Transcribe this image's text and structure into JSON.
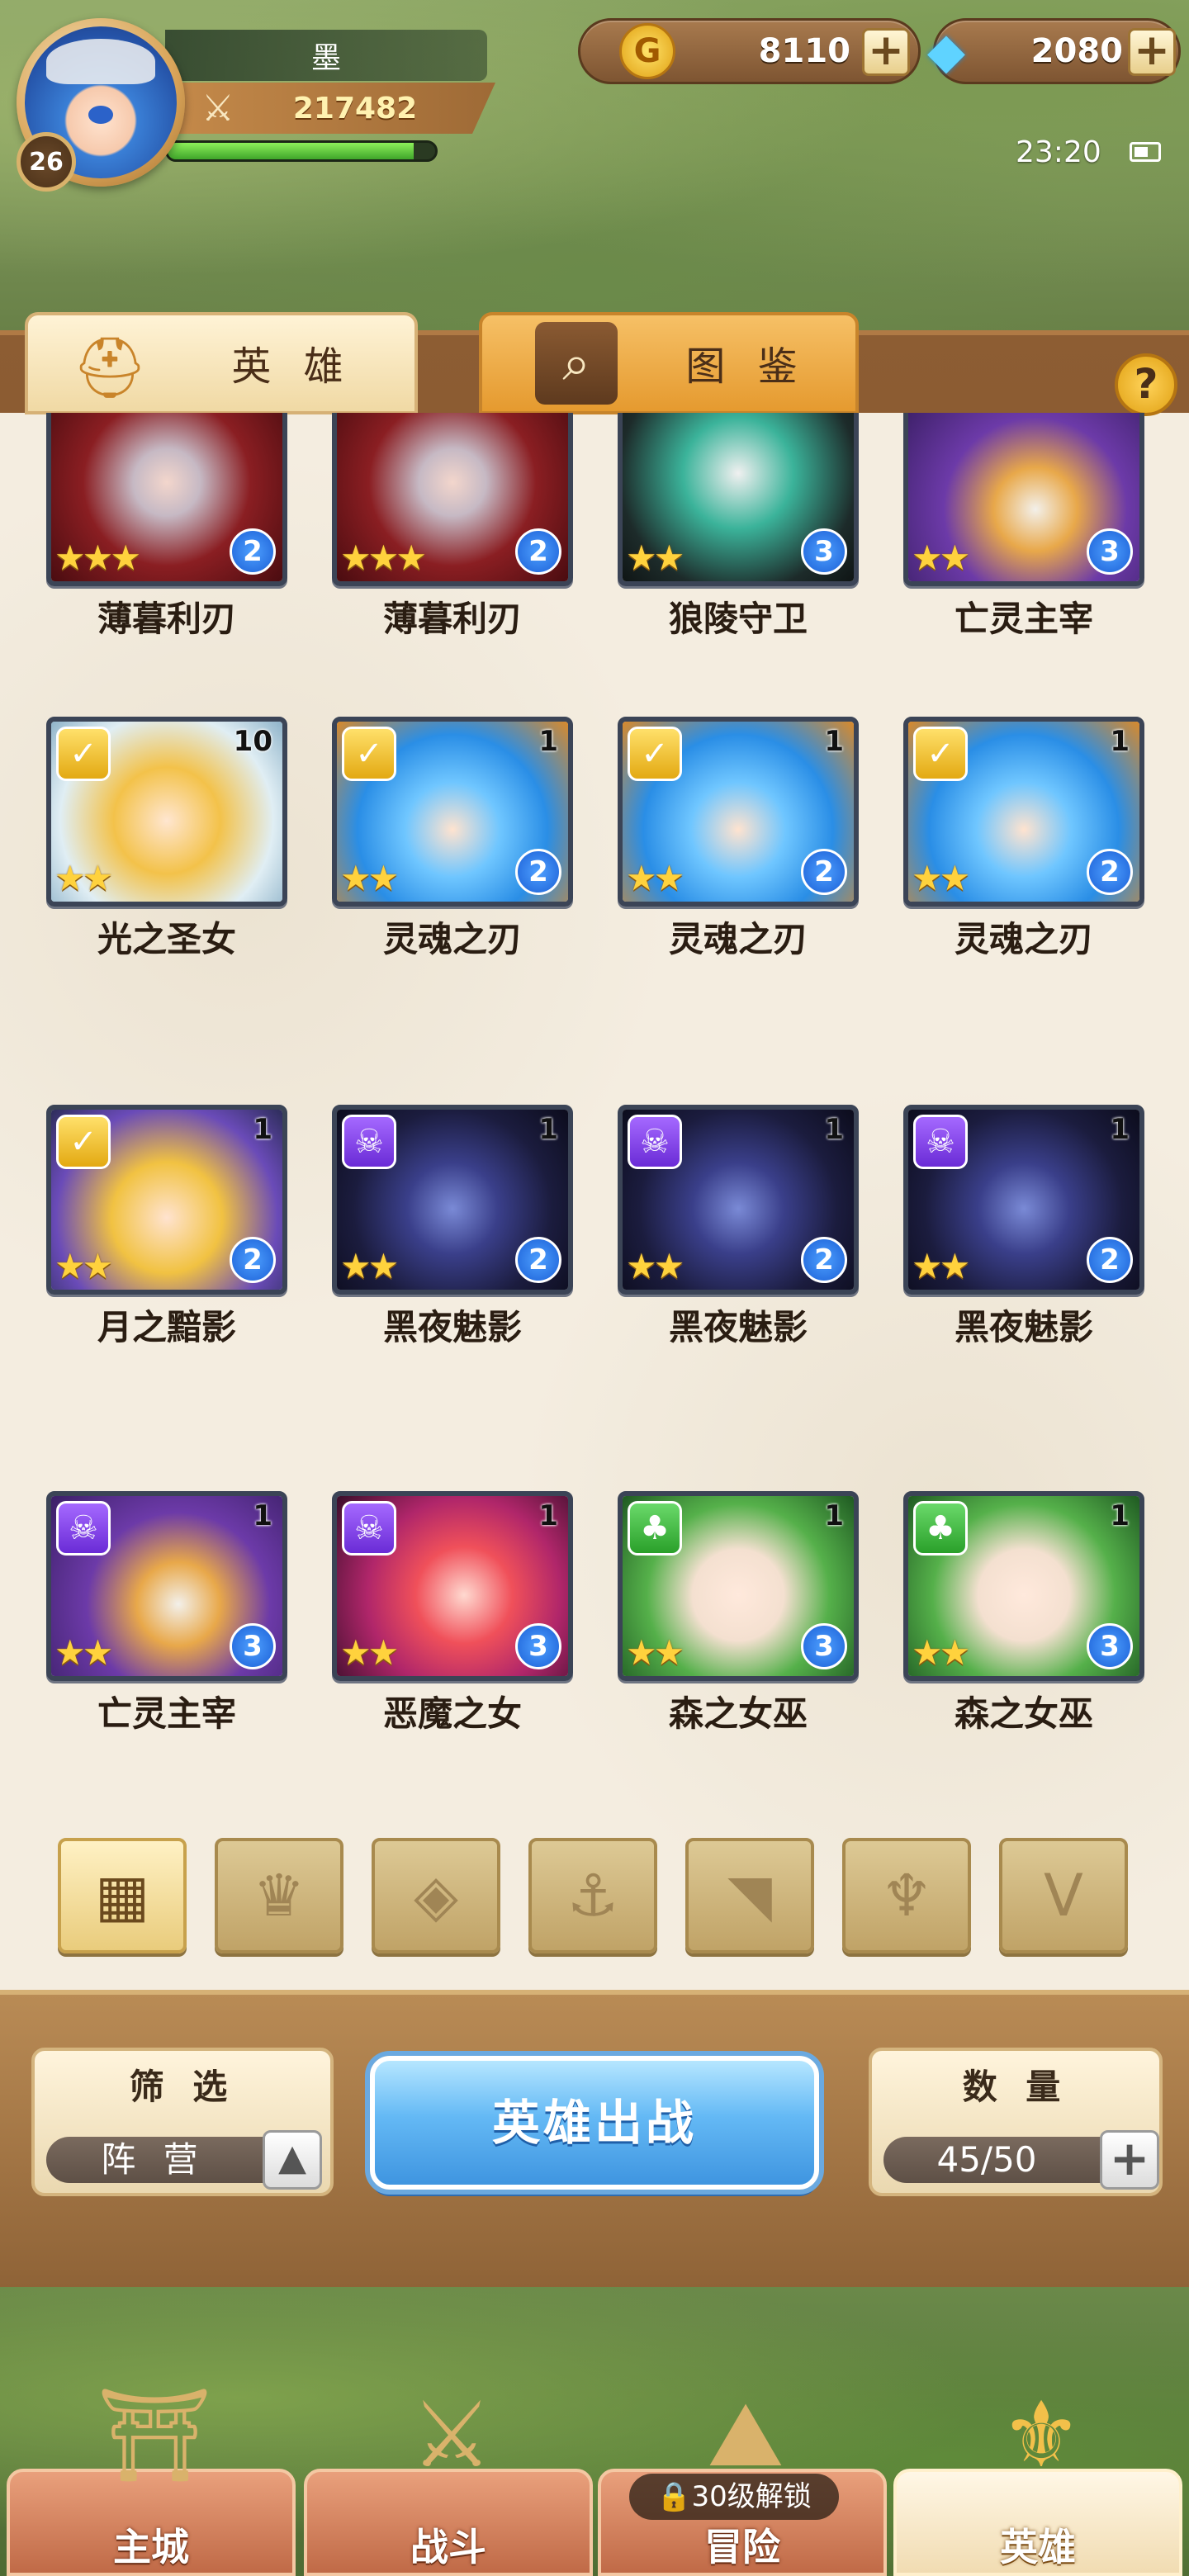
{
  "player": {
    "name": "墨",
    "level": "26",
    "power": "217482",
    "exp_fraction": 0.92
  },
  "resources": {
    "coin": "8110",
    "gem": "2080"
  },
  "status_bar": {
    "time": "23:20"
  },
  "tabs": [
    {
      "label": "英 雄",
      "active": true
    },
    {
      "label": "图 鉴",
      "active": false
    }
  ],
  "help_label": "?",
  "heroes": [
    {
      "name": "薄暮利刃",
      "stars": 3,
      "level": "2",
      "count": "",
      "faction": "",
      "palette": "red"
    },
    {
      "name": "薄暮利刃",
      "stars": 3,
      "level": "2",
      "count": "",
      "faction": "",
      "palette": "red"
    },
    {
      "name": "狼陵守卫",
      "stars": 2,
      "level": "3",
      "count": "",
      "faction": "",
      "palette": "teal"
    },
    {
      "name": "亡灵主宰",
      "stars": 2,
      "level": "3",
      "count": "",
      "faction": "",
      "palette": "purple"
    },
    {
      "name": "光之圣女",
      "stars": 2,
      "level": "",
      "count": "10",
      "faction": "light",
      "palette": "gold"
    },
    {
      "name": "灵魂之刃",
      "stars": 2,
      "level": "2",
      "count": "1",
      "faction": "light",
      "palette": "blue"
    },
    {
      "name": "灵魂之刃",
      "stars": 2,
      "level": "2",
      "count": "1",
      "faction": "light",
      "palette": "blue"
    },
    {
      "name": "灵魂之刃",
      "stars": 2,
      "level": "2",
      "count": "1",
      "faction": "light",
      "palette": "blue"
    },
    {
      "name": "月之黯影",
      "stars": 2,
      "level": "2",
      "count": "1",
      "faction": "light",
      "palette": "gold2"
    },
    {
      "name": "黑夜魅影",
      "stars": 2,
      "level": "2",
      "count": "1",
      "faction": "dark",
      "palette": "night"
    },
    {
      "name": "黑夜魅影",
      "stars": 2,
      "level": "2",
      "count": "1",
      "faction": "dark",
      "palette": "night"
    },
    {
      "name": "黑夜魅影",
      "stars": 2,
      "level": "2",
      "count": "1",
      "faction": "dark",
      "palette": "night"
    },
    {
      "name": "亡灵主宰",
      "stars": 2,
      "level": "3",
      "count": "1",
      "faction": "dark",
      "palette": "purple"
    },
    {
      "name": "恶魔之女",
      "stars": 2,
      "level": "3",
      "count": "1",
      "faction": "dark",
      "palette": "demon"
    },
    {
      "name": "森之女巫",
      "stars": 2,
      "level": "3",
      "count": "1",
      "faction": "nature",
      "palette": "forest"
    },
    {
      "name": "森之女巫",
      "stars": 2,
      "level": "3",
      "count": "1",
      "faction": "nature",
      "palette": "forest"
    }
  ],
  "filter_icons": [
    {
      "name": "all-filter-icon",
      "glyph": "▦",
      "active": true
    },
    {
      "name": "light-faction-filter-icon",
      "glyph": "♛",
      "active": false
    },
    {
      "name": "diamond-faction-filter-icon",
      "glyph": "◈",
      "active": false
    },
    {
      "name": "anchor-faction-filter-icon",
      "glyph": "⚓",
      "active": false
    },
    {
      "name": "beast-faction-filter-icon",
      "glyph": "◥",
      "active": false
    },
    {
      "name": "dark-faction-filter-icon",
      "glyph": "♆",
      "active": false
    },
    {
      "name": "chevron-faction-filter-icon",
      "glyph": "V",
      "active": false
    }
  ],
  "controls": {
    "filter_title": "筛 选",
    "filter_value": "阵 营",
    "deploy_label": "英雄出战",
    "count_title": "数 量",
    "count_value": "45/50"
  },
  "nav": [
    {
      "label": "主城",
      "icon": "castle-icon",
      "glyph": "⛩",
      "active": false
    },
    {
      "label": "战斗",
      "icon": "crossed-swords-icon",
      "glyph": "⚔",
      "active": false
    },
    {
      "label": "冒险",
      "icon": "map-icon",
      "glyph": "⛰",
      "active": false
    },
    {
      "label": "英雄",
      "icon": "hero-helmet-icon",
      "glyph": "⚜",
      "active": true
    }
  ],
  "lock_tag": "🔒30级解锁",
  "colors": {
    "paper": "#f4ede0",
    "wood": "#8d5d33",
    "star": "#ffd23d",
    "level_badge": "#1b5fd6",
    "deploy_button": "#3f95e0"
  }
}
